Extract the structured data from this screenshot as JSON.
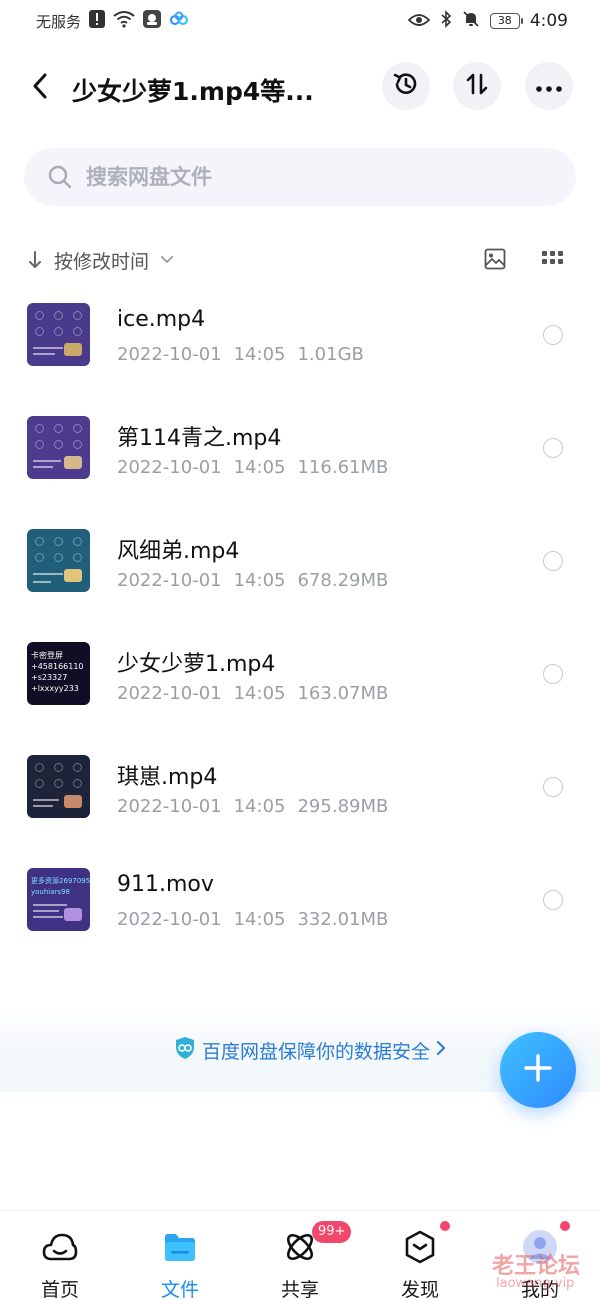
{
  "status_bar": {
    "carrier": "无服务",
    "battery": "38",
    "time": "4:09"
  },
  "header": {
    "title": "少女少萝1.mp4等..."
  },
  "search": {
    "placeholder": "搜索网盘文件"
  },
  "sort": {
    "label": "按修改时间"
  },
  "files": [
    {
      "name": "ice.mp4",
      "date": "2022-10-01",
      "time": "14:05",
      "size": "1.01GB",
      "thumb_color": "#4a3a8c"
    },
    {
      "name": "第114青之.mp4",
      "date": "2022-10-01",
      "time": "14:05",
      "size": "116.61MB",
      "thumb_color": "#4c3b8e"
    },
    {
      "name": "风细弟.mp4",
      "date": "2022-10-01",
      "time": "14:05",
      "size": "678.29MB",
      "thumb_color": "#1f5f7a"
    },
    {
      "name": "少女少萝1.mp4",
      "date": "2022-10-01",
      "time": "14:05",
      "size": "163.07MB",
      "thumb_color": "#120d24"
    },
    {
      "name": "琪崽.mp4",
      "date": "2022-10-01",
      "time": "14:05",
      "size": "295.89MB",
      "thumb_color": "#1d2338"
    },
    {
      "name": "911.mov",
      "date": "2022-10-01",
      "time": "14:05",
      "size": "332.01MB",
      "thumb_color": "#3f3184"
    }
  ],
  "thumb_text": {
    "f4": "卡密登屏\n+458166110\n+s23327\n+lxxxyy233",
    "f6": "更多资源269709574\nyouhiars98"
  },
  "security": {
    "text": "百度网盘保障你的数据安全"
  },
  "nav": {
    "home": "首页",
    "files": "文件",
    "share": "共享",
    "share_badge": "99+",
    "discover": "发现",
    "mine": "我的"
  },
  "watermark": {
    "main": "老王论坛",
    "sub": "laowang.vip"
  },
  "colors": {
    "accent": "#1a8cf0",
    "badge": "#f0476a",
    "secure": "#2b7bd8"
  }
}
